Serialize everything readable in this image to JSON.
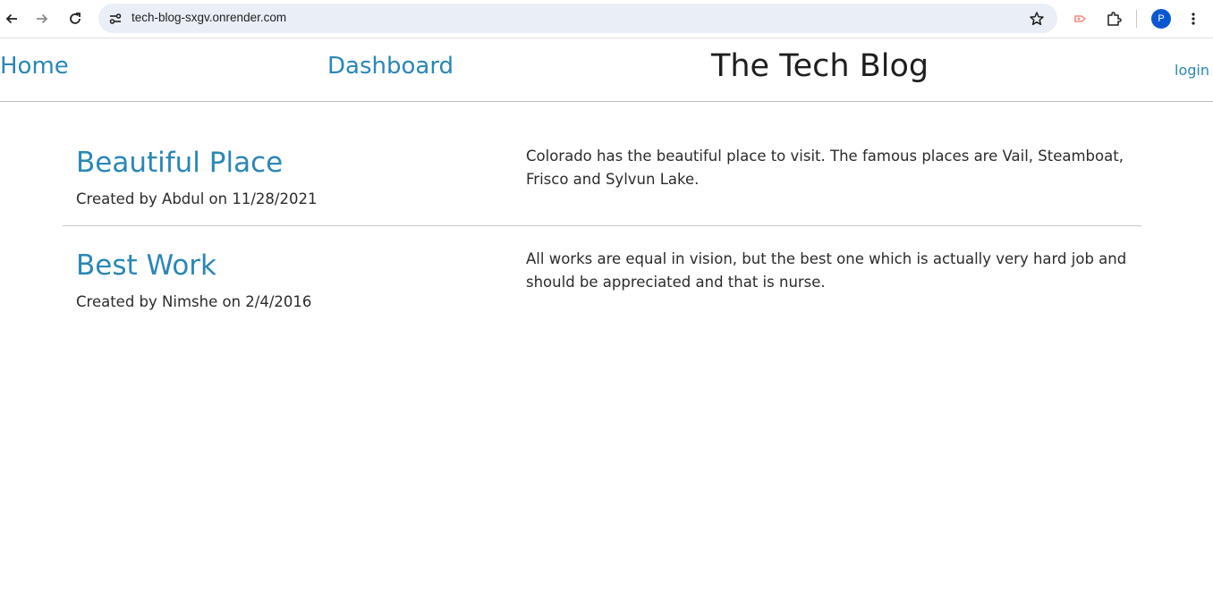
{
  "browser": {
    "url": "tech-blog-sxgv.onrender.com",
    "profile_initial": "P",
    "icons": [
      "back-arrow-icon",
      "forward-arrow-icon",
      "reload-icon",
      "site-info-icon",
      "bookmark-star-icon",
      "extension-icon",
      "puzzle-icon",
      "kebab-menu-icon"
    ]
  },
  "header": {
    "home_label": "Home",
    "dashboard_label": "Dashboard",
    "site_title": "The Tech Blog",
    "login_label": "login"
  },
  "posts": [
    {
      "title": "Beautiful Place",
      "meta": "Created by Abdul on 11/28/2021",
      "body": "Colorado has the beautiful place to visit. The famous places are Vail, Steamboat, Frisco and Sylvun Lake."
    },
    {
      "title": "Best Work",
      "meta": "Created by Nimshe on 2/4/2016",
      "body": "All works are equal in vision, but the best one which is actually very hard job and should be appreciated and that is nurse."
    }
  ],
  "colors": {
    "link": "#2a87b6",
    "text": "#2b2b2b",
    "title": "#1e1e1e",
    "omnibox": "#e9eef7",
    "avatar": "#0b57d0"
  }
}
